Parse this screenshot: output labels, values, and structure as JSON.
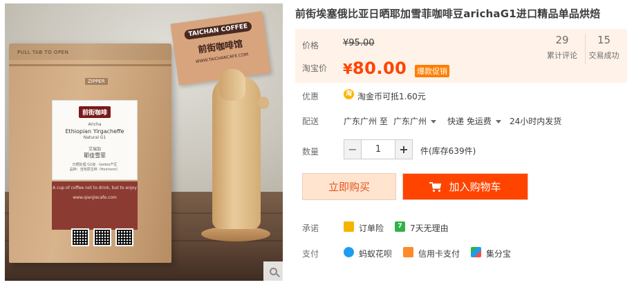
{
  "product": {
    "title": "前街埃塞俄比亚日晒耶加雪菲咖啡豆arichaG1进口精品单品烘焙"
  },
  "image": {
    "bag_zip_text": "PULL TAB TO OPEN",
    "bag_zipper_text": "ZIPPER",
    "label_brand": "前街咖啡",
    "label_line1": "Aricha",
    "label_line2": "Ethiopian Yirgacheffe",
    "label_line3": "Natural G1",
    "label_line4": "艾瑞加",
    "label_line5": "耶佳雪菲",
    "label_line6": "日晒处理 G1级 · Gedeo产区",
    "label_line7": "品种：当地原生种（Heirloom）",
    "band_text": "A cup of coffee not to drink, but to enjoy",
    "band_url": "www.qianjiecafe.com",
    "sign_brand": "TAICHAN COFFEE",
    "sign_name": "前街咖啡馆",
    "sign_url": "WWW.TAICHANCAFE.COM"
  },
  "price": {
    "label": "价格",
    "original": "¥95.00",
    "taobao_label": "淘宝价",
    "currency": "¥",
    "current": "80.00",
    "promo_badge": "爆款促销"
  },
  "stats": {
    "reviews_count": "29",
    "reviews_label": "累计评论",
    "deals_count": "15",
    "deals_label": "交易成功"
  },
  "discount": {
    "label": "优惠",
    "icon": "淘",
    "text": "淘金币可抵1.60元"
  },
  "delivery": {
    "label": "配送",
    "from": "广东广州 至",
    "to": "广东广州",
    "method": "快递 免运费",
    "eta": "24小时内发货"
  },
  "quantity": {
    "label": "数量",
    "value": "1",
    "minus": "−",
    "plus": "+",
    "stock": "件(库存639件)"
  },
  "actions": {
    "buy_now": "立即购买",
    "add_to_cart": "加入购物车"
  },
  "promise": {
    "label": "承诺",
    "items": [
      "订单险",
      "7天无理由"
    ],
    "seven_icon": "7"
  },
  "payment": {
    "label": "支付",
    "items": [
      "蚂蚁花呗",
      "信用卡支付",
      "集分宝"
    ]
  },
  "colors": {
    "accent": "#ff4400",
    "price_bg": "#fff2e8",
    "buy_now_bg": "#ffe4d0",
    "promo": "#ff7e00"
  }
}
